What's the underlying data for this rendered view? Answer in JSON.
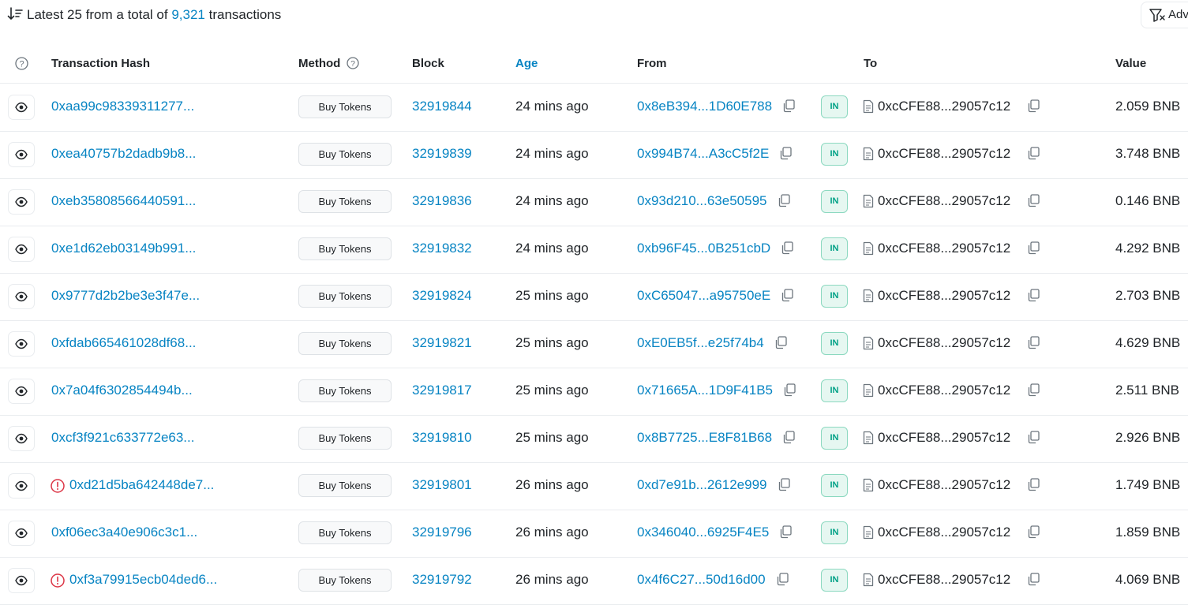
{
  "summary": {
    "prefix": "Latest 25 from a total of",
    "total": "9,321",
    "suffix": "transactions"
  },
  "advanced_button": {
    "label": "Adv"
  },
  "columns": {
    "hash": "Transaction Hash",
    "method": "Method",
    "block": "Block",
    "age": "Age",
    "from": "From",
    "to": "To",
    "value": "Value"
  },
  "colors": {
    "link": "#0784c3",
    "error": "#dc3545",
    "in_badge_text": "#00a186",
    "in_badge_bg": "#e6f7f1",
    "border": "#e9ecef"
  },
  "icons": {
    "sort": "sort-descending-icon",
    "help": "question-circle-icon",
    "view": "eye-icon",
    "error": "exclamation-circle-icon",
    "copy": "copy-icon",
    "contract": "document-icon",
    "filter": "filter-icon"
  },
  "transactions": [
    {
      "hash": "0xaa99c98339311277...",
      "error": false,
      "method": "Buy Tokens",
      "block": "32919844",
      "age": "24 mins ago",
      "from": "0x8eB394...1D60E788",
      "direction": "IN",
      "to": "0xcCFE88...29057c12",
      "value": "2.059 BNB"
    },
    {
      "hash": "0xea40757b2dadb9b8...",
      "error": false,
      "method": "Buy Tokens",
      "block": "32919839",
      "age": "24 mins ago",
      "from": "0x994B74...A3cC5f2E",
      "direction": "IN",
      "to": "0xcCFE88...29057c12",
      "value": "3.748 BNB"
    },
    {
      "hash": "0xeb35808566440591...",
      "error": false,
      "method": "Buy Tokens",
      "block": "32919836",
      "age": "24 mins ago",
      "from": "0x93d210...63e50595",
      "direction": "IN",
      "to": "0xcCFE88...29057c12",
      "value": "0.146 BNB"
    },
    {
      "hash": "0xe1d62eb03149b991...",
      "error": false,
      "method": "Buy Tokens",
      "block": "32919832",
      "age": "24 mins ago",
      "from": "0xb96F45...0B251cbD",
      "direction": "IN",
      "to": "0xcCFE88...29057c12",
      "value": "4.292 BNB"
    },
    {
      "hash": "0x9777d2b2be3e3f47e...",
      "error": false,
      "method": "Buy Tokens",
      "block": "32919824",
      "age": "25 mins ago",
      "from": "0xC65047...a95750eE",
      "direction": "IN",
      "to": "0xcCFE88...29057c12",
      "value": "2.703 BNB"
    },
    {
      "hash": "0xfdab665461028df68...",
      "error": false,
      "method": "Buy Tokens",
      "block": "32919821",
      "age": "25 mins ago",
      "from": "0xE0EB5f...e25f74b4",
      "direction": "IN",
      "to": "0xcCFE88...29057c12",
      "value": "4.629 BNB"
    },
    {
      "hash": "0x7a04f6302854494b...",
      "error": false,
      "method": "Buy Tokens",
      "block": "32919817",
      "age": "25 mins ago",
      "from": "0x71665A...1D9F41B5",
      "direction": "IN",
      "to": "0xcCFE88...29057c12",
      "value": "2.511 BNB"
    },
    {
      "hash": "0xcf3f921c633772e63...",
      "error": false,
      "method": "Buy Tokens",
      "block": "32919810",
      "age": "25 mins ago",
      "from": "0x8B7725...E8F81B68",
      "direction": "IN",
      "to": "0xcCFE88...29057c12",
      "value": "2.926 BNB"
    },
    {
      "hash": "0xd21d5ba642448de7...",
      "error": true,
      "method": "Buy Tokens",
      "block": "32919801",
      "age": "26 mins ago",
      "from": "0xd7e91b...2612e999",
      "direction": "IN",
      "to": "0xcCFE88...29057c12",
      "value": "1.749 BNB"
    },
    {
      "hash": "0xf06ec3a40e906c3c1...",
      "error": false,
      "method": "Buy Tokens",
      "block": "32919796",
      "age": "26 mins ago",
      "from": "0x346040...6925F4E5",
      "direction": "IN",
      "to": "0xcCFE88...29057c12",
      "value": "1.859 BNB"
    },
    {
      "hash": "0xf3a79915ecb04ded6...",
      "error": true,
      "method": "Buy Tokens",
      "block": "32919792",
      "age": "26 mins ago",
      "from": "0x4f6C27...50d16d00",
      "direction": "IN",
      "to": "0xcCFE88...29057c12",
      "value": "4.069 BNB"
    }
  ]
}
